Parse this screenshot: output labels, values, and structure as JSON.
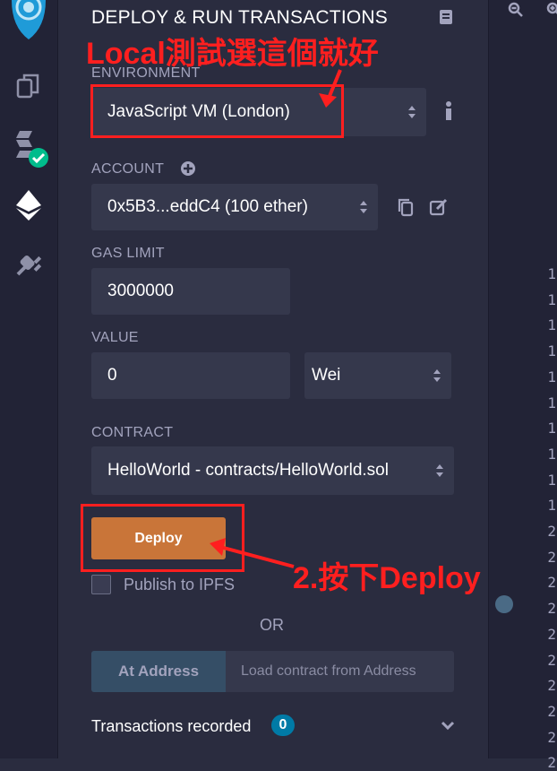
{
  "header": {
    "title": "DEPLOY & RUN TRANSACTIONS"
  },
  "environment": {
    "label": "ENVIRONMENT",
    "value": "JavaScript VM (London)"
  },
  "account": {
    "label": "ACCOUNT",
    "value": "0x5B3...eddC4 (100 ether)"
  },
  "gas": {
    "label": "GAS LIMIT",
    "value": "3000000"
  },
  "value_field": {
    "label": "VALUE",
    "amount": "0",
    "unit": "Wei"
  },
  "contract": {
    "label": "CONTRACT",
    "value": "HelloWorld - contracts/HelloWorld.sol"
  },
  "deploy": {
    "button": "Deploy",
    "publish_label": "Publish to IPFS"
  },
  "or_label": "OR",
  "at_address": {
    "button": "At Address",
    "placeholder": "Load contract from Address"
  },
  "transactions": {
    "label": "Transactions recorded",
    "count": "0"
  },
  "annotations": {
    "env_note": "Local測試選這個就好",
    "deploy_note": "2.按下Deploy"
  },
  "editor": {
    "line_numbers": [
      "1",
      "1",
      "1",
      "1",
      "1",
      "1",
      "1",
      "1",
      "1",
      "1",
      "2",
      "2",
      "2",
      "2",
      "2",
      "2",
      "2",
      "2",
      "2",
      "2"
    ]
  },
  "colors": {
    "accent_orange": "#c97539",
    "annotation_red": "#ff1f1f",
    "badge_blue": "#007aa6",
    "panel_bg": "#2a2c3f"
  }
}
